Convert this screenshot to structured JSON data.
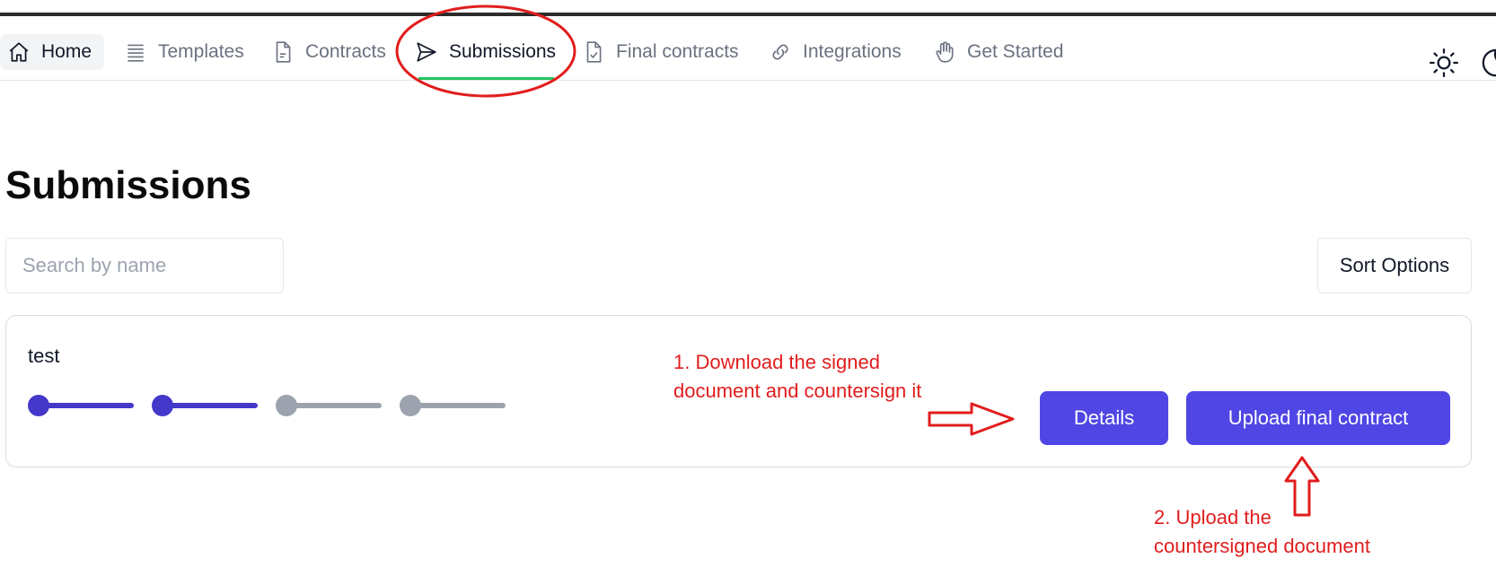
{
  "nav": {
    "items": [
      {
        "label": "Home",
        "icon": "home-icon"
      },
      {
        "label": "Templates",
        "icon": "list-icon"
      },
      {
        "label": "Contracts",
        "icon": "document-icon"
      },
      {
        "label": "Submissions",
        "icon": "send-icon"
      },
      {
        "label": "Final contracts",
        "icon": "document-check-icon"
      },
      {
        "label": "Integrations",
        "icon": "link-icon"
      },
      {
        "label": "Get Started",
        "icon": "hand-icon"
      }
    ],
    "active": "Submissions"
  },
  "page": {
    "title": "Submissions"
  },
  "search": {
    "placeholder": "Search by name",
    "value": ""
  },
  "sort": {
    "label": "Sort Options"
  },
  "submissions": [
    {
      "name": "test",
      "steps_total": 4,
      "steps_completed": 2,
      "actions": {
        "details": "Details",
        "upload": "Upload final contract"
      }
    }
  ],
  "annotations": {
    "step1_line1": "1. Download the signed",
    "step1_line2": "document and countersign it",
    "step2_line1": "2. Upload the",
    "step2_line2": "countersigned document"
  },
  "colors": {
    "primary": "#4f46e5",
    "progress_done": "#4338ca",
    "progress_todo": "#9ca3af",
    "active_underline": "#22c55e",
    "annotation": "#e11d1d"
  }
}
